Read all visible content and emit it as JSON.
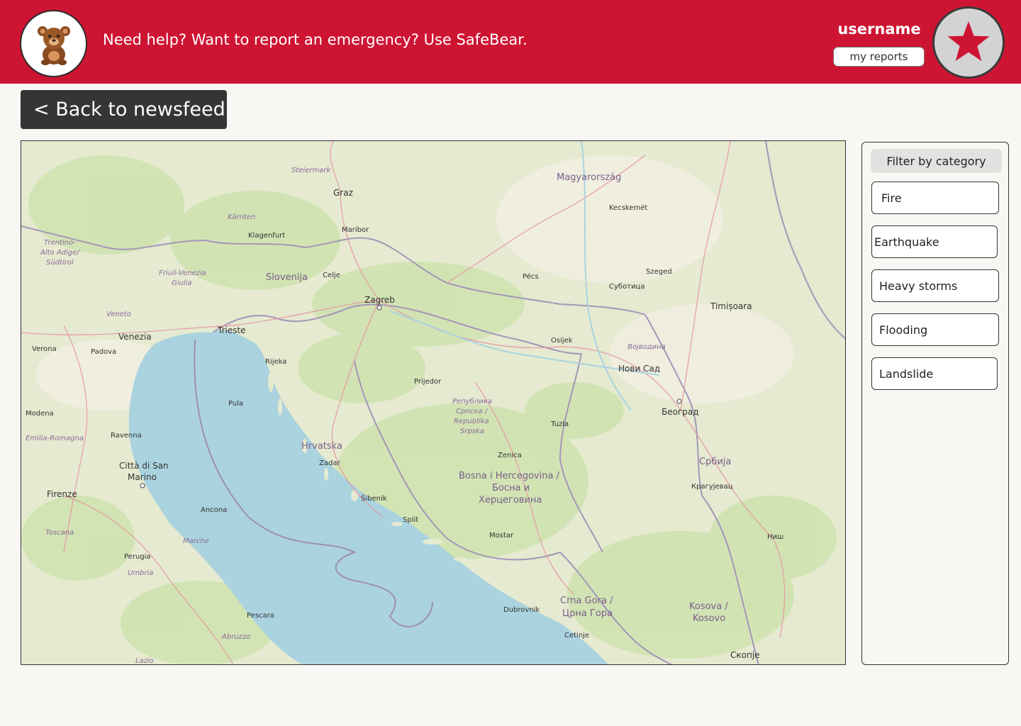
{
  "header": {
    "tagline": "Need help?  Want to report an emergency?  Use SafeBear.",
    "username": "username",
    "my_reports_label": "my reports",
    "logo_icon": "teddy-bear-icon",
    "avatar_icon": "star-icon"
  },
  "back_button": {
    "label": "< Back to newsfeed"
  },
  "map": {
    "labels": {
      "slovenija": "Slovenija",
      "hrvatska": "Hrvatska",
      "bih1": "Bosna i Hercegovina /",
      "bih2": "Босна и",
      "bih3": "Херцеговина",
      "srbija": "Србија",
      "magyarorszag": "Magyarország",
      "crnagora1": "Crna Gora /",
      "crnagora2": "Црна Гора",
      "kosova1": "Kosova /",
      "kosova2": "Kosovo",
      "zagreb": "Zagreb",
      "beograd": "Београд",
      "novisad": "Нови Сад",
      "trieste": "Trieste",
      "venezia": "Venezia",
      "graz": "Graz",
      "firenze": "Firenze",
      "rijeka": "Rijeka",
      "split": "Split",
      "zadar": "Zadar",
      "osijek": "Osijek",
      "sarajevo": "Tuzla",
      "mostar": "Mostar",
      "dubrovnik": "Dubrovnik",
      "timisoara": "Timișoara",
      "szeged": "Szeged",
      "pecs": "Pécs",
      "skopje": "Скопје",
      "ancona": "Ancona",
      "pescara": "Pescara",
      "niš": "Ниш",
      "sanmarino1": "Città di San",
      "sanmarino2": "Marino",
      "ljubljana": "Celje",
      "klagenfurt": "Klagenfurt",
      "maribor": "Maribor",
      "padova": "Padova",
      "verona": "Verona",
      "modena": "Modena",
      "ravenna": "Ravenna",
      "perugia": "Perugia",
      "podgorica": "Cetinje",
      "pula": "Pula",
      "sibenik": "Šibenik",
      "kecskemet": "Kecskemét",
      "subotica": "Суботица",
      "kragujevac": "Крагујевац",
      "zenica": "Zenica",
      "banjaluka": "Prijedor",
      "emilia": "Emilia-Romagna",
      "toscana": "Toscana",
      "marche": "Marche",
      "umbria": "Umbria",
      "abruzzo": "Abruzzo",
      "lazio": "Lazio",
      "karnten": "Kärnten",
      "steiermark": "Steiermark",
      "vojvodina": "Војводина",
      "rs1": "Република",
      "rs2": "Српска /",
      "rs3": "Republika",
      "rs4": "Srpska",
      "friuli1": "Friuli-Venezia",
      "friuli2": "Giulia",
      "veneto": "Veneto",
      "trentino1": "Trentino-",
      "trentino2": "Alto Adige/",
      "trentino3": "Südtirol"
    }
  },
  "filter": {
    "title": "Filter by category",
    "items": [
      "Fire",
      "Earthquake",
      "Heavy storms",
      "Flooding",
      "Landslide"
    ]
  },
  "colors": {
    "brand_red": "#ce1433",
    "dark_button": "#333634",
    "sea": "#aad3df",
    "land": "#e9ecd6"
  }
}
